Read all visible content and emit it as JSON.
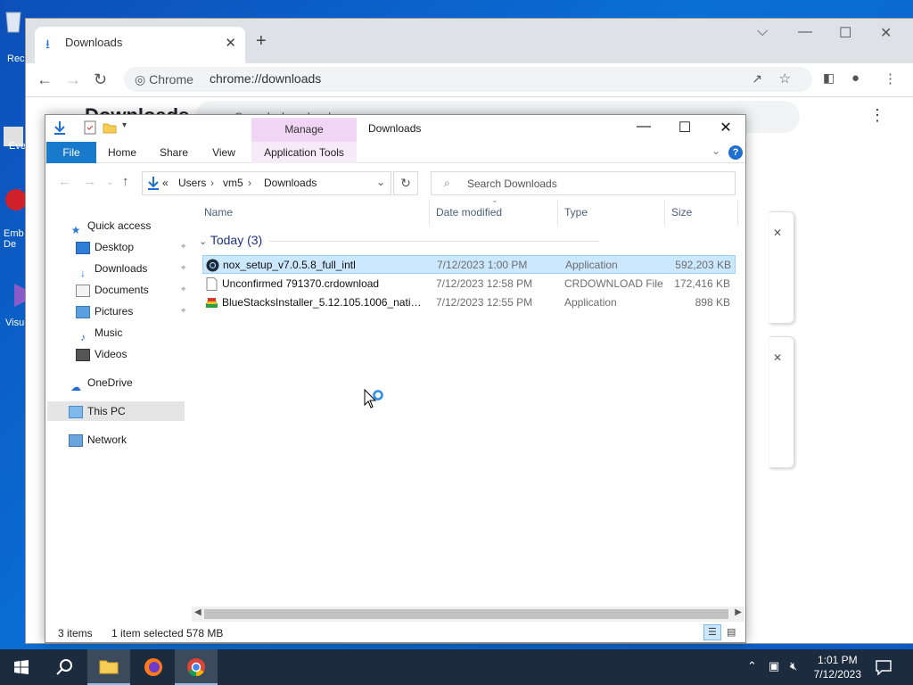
{
  "desktop": {
    "icons": [
      {
        "label": "Rec"
      },
      {
        "label": "Eve"
      },
      {
        "label": "Emb De"
      },
      {
        "label": "Visu"
      }
    ]
  },
  "chrome": {
    "tab_title": "Downloads",
    "site_label": "Chrome",
    "url": "chrome://downloads",
    "page_title": "Downloads",
    "search_placeholder": "Search downloads"
  },
  "explorer": {
    "window_title": "Downloads",
    "contextual_tab": "Manage",
    "ribbon_tabs": [
      "File",
      "Home",
      "Share",
      "View",
      "Application Tools"
    ],
    "breadcrumb": [
      "«",
      "Users",
      "vm5",
      "Downloads"
    ],
    "search_placeholder": "Search Downloads",
    "nav": {
      "quick_access": "Quick access",
      "items": [
        {
          "label": "Desktop",
          "pinned": true
        },
        {
          "label": "Downloads",
          "pinned": true
        },
        {
          "label": "Documents",
          "pinned": true
        },
        {
          "label": "Pictures",
          "pinned": true
        },
        {
          "label": "Music",
          "pinned": false
        },
        {
          "label": "Videos",
          "pinned": false
        }
      ],
      "onedrive": "OneDrive",
      "this_pc": "This PC",
      "network": "Network"
    },
    "columns": [
      "Name",
      "Date modified",
      "Type",
      "Size"
    ],
    "group_label": "Today (3)",
    "files": [
      {
        "name": "nox_setup_v7.0.5.8_full_intl",
        "date": "7/12/2023 1:00 PM",
        "type": "Application",
        "size": "592,203 KB",
        "selected": true,
        "icon": "nox-icon"
      },
      {
        "name": "Unconfirmed 791370.crdownload",
        "date": "7/12/2023 12:58 PM",
        "type": "CRDOWNLOAD File",
        "size": "172,416 KB",
        "selected": false,
        "icon": "blank-file-icon"
      },
      {
        "name": "BlueStacksInstaller_5.12.105.1006_native_...",
        "date": "7/12/2023 12:55 PM",
        "type": "Application",
        "size": "898 KB",
        "selected": false,
        "icon": "bluestacks-icon"
      }
    ],
    "status": {
      "items": "3 items",
      "selected": "1 item selected",
      "size": "578 MB"
    }
  },
  "taskbar": {
    "time": "1:01 PM",
    "date": "7/12/2023"
  },
  "colors": {
    "desktop_bg": "#0a64c8",
    "selection": "#cce8ff",
    "file_tab": "#1979ca",
    "manage_tab": "#f1d5f5",
    "taskbar": "#1c2b3d"
  }
}
